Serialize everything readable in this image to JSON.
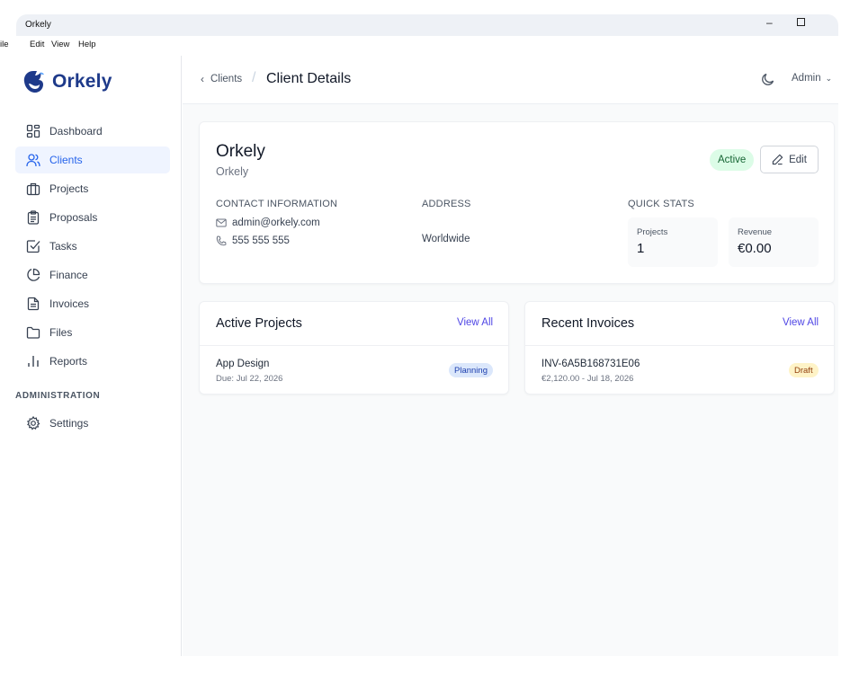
{
  "window": {
    "title": "Orkely",
    "minimize": "–"
  },
  "menu": [
    "ile",
    "Edit",
    "View",
    "Help"
  ],
  "app": {
    "name": "Orkely"
  },
  "sidebar": {
    "items": [
      {
        "label": "Dashboard",
        "icon": "dashboard-icon"
      },
      {
        "label": "Clients",
        "icon": "users-icon",
        "active": true
      },
      {
        "label": "Projects",
        "icon": "briefcase-icon"
      },
      {
        "label": "Proposals",
        "icon": "clipboard-icon"
      },
      {
        "label": "Tasks",
        "icon": "checkbox-icon"
      },
      {
        "label": "Finance",
        "icon": "pie-chart-icon"
      },
      {
        "label": "Invoices",
        "icon": "file-text-icon"
      },
      {
        "label": "Files",
        "icon": "folder-icon"
      },
      {
        "label": "Reports",
        "icon": "bar-chart-icon"
      }
    ],
    "admin_section": "ADMINISTRATION",
    "settings": {
      "label": "Settings",
      "icon": "gear-icon"
    }
  },
  "header": {
    "back": "Clients",
    "separator": "/",
    "title": "Client Details",
    "user": "Admin"
  },
  "client": {
    "name": "Orkely",
    "company": "Orkely",
    "status": "Active",
    "edit_label": "Edit",
    "contact_heading": "CONTACT INFORMATION",
    "email": "admin@orkely.com",
    "phone": "555 555 555",
    "address_heading": "ADDRESS",
    "address": "Worldwide",
    "stats_heading": "QUICK STATS",
    "stats": {
      "projects_label": "Projects",
      "projects_value": "1",
      "revenue_label": "Revenue",
      "revenue_value": "€0.00"
    }
  },
  "projects": {
    "title": "Active Projects",
    "view_all": "View All",
    "items": [
      {
        "name": "App Design",
        "due": "Due: Jul 22, 2026",
        "status": "Planning"
      }
    ]
  },
  "invoices": {
    "title": "Recent Invoices",
    "view_all": "View All",
    "items": [
      {
        "number": "INV-6A5B168731E06",
        "detail": "€2,120.00 - Jul 18, 2026",
        "status": "Draft"
      }
    ]
  },
  "colors": {
    "accent": "#2563eb",
    "brand": "#1e3a8a",
    "active_badge_bg": "#dcfce7",
    "planning_bg": "#dbe7fb",
    "draft_bg": "#fef3c7"
  }
}
